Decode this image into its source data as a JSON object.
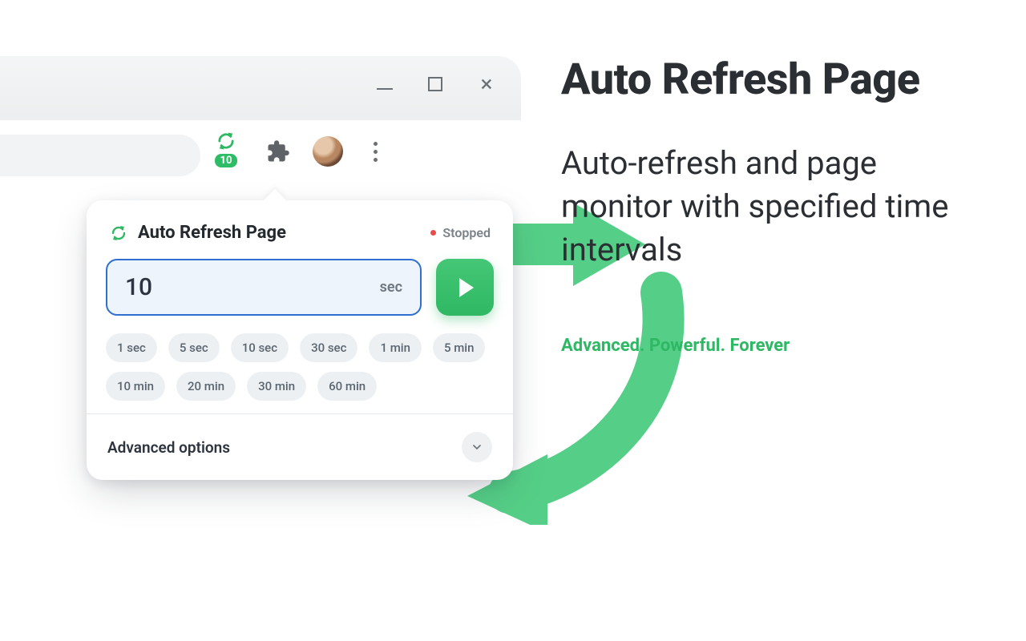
{
  "browser": {
    "extension_badge": "10"
  },
  "popup": {
    "title": "Auto Refresh Page",
    "status_label": "Stopped",
    "interval_value": "10",
    "interval_unit": "sec",
    "presets": [
      "1 sec",
      "5 sec",
      "10 sec",
      "30 sec",
      "1 min",
      "5 min",
      "10 min",
      "20 min",
      "30 min",
      "60 min"
    ],
    "advanced_label": "Advanced options"
  },
  "hero": {
    "title": "Auto Refresh Page",
    "subtitle": "Auto-refresh and page monitor with specified time intervals",
    "tagline": "Advanced. Powerful. Forever"
  },
  "colors": {
    "accent": "#2fb864",
    "input_border": "#2f6fd0",
    "danger": "#e94b4b"
  }
}
